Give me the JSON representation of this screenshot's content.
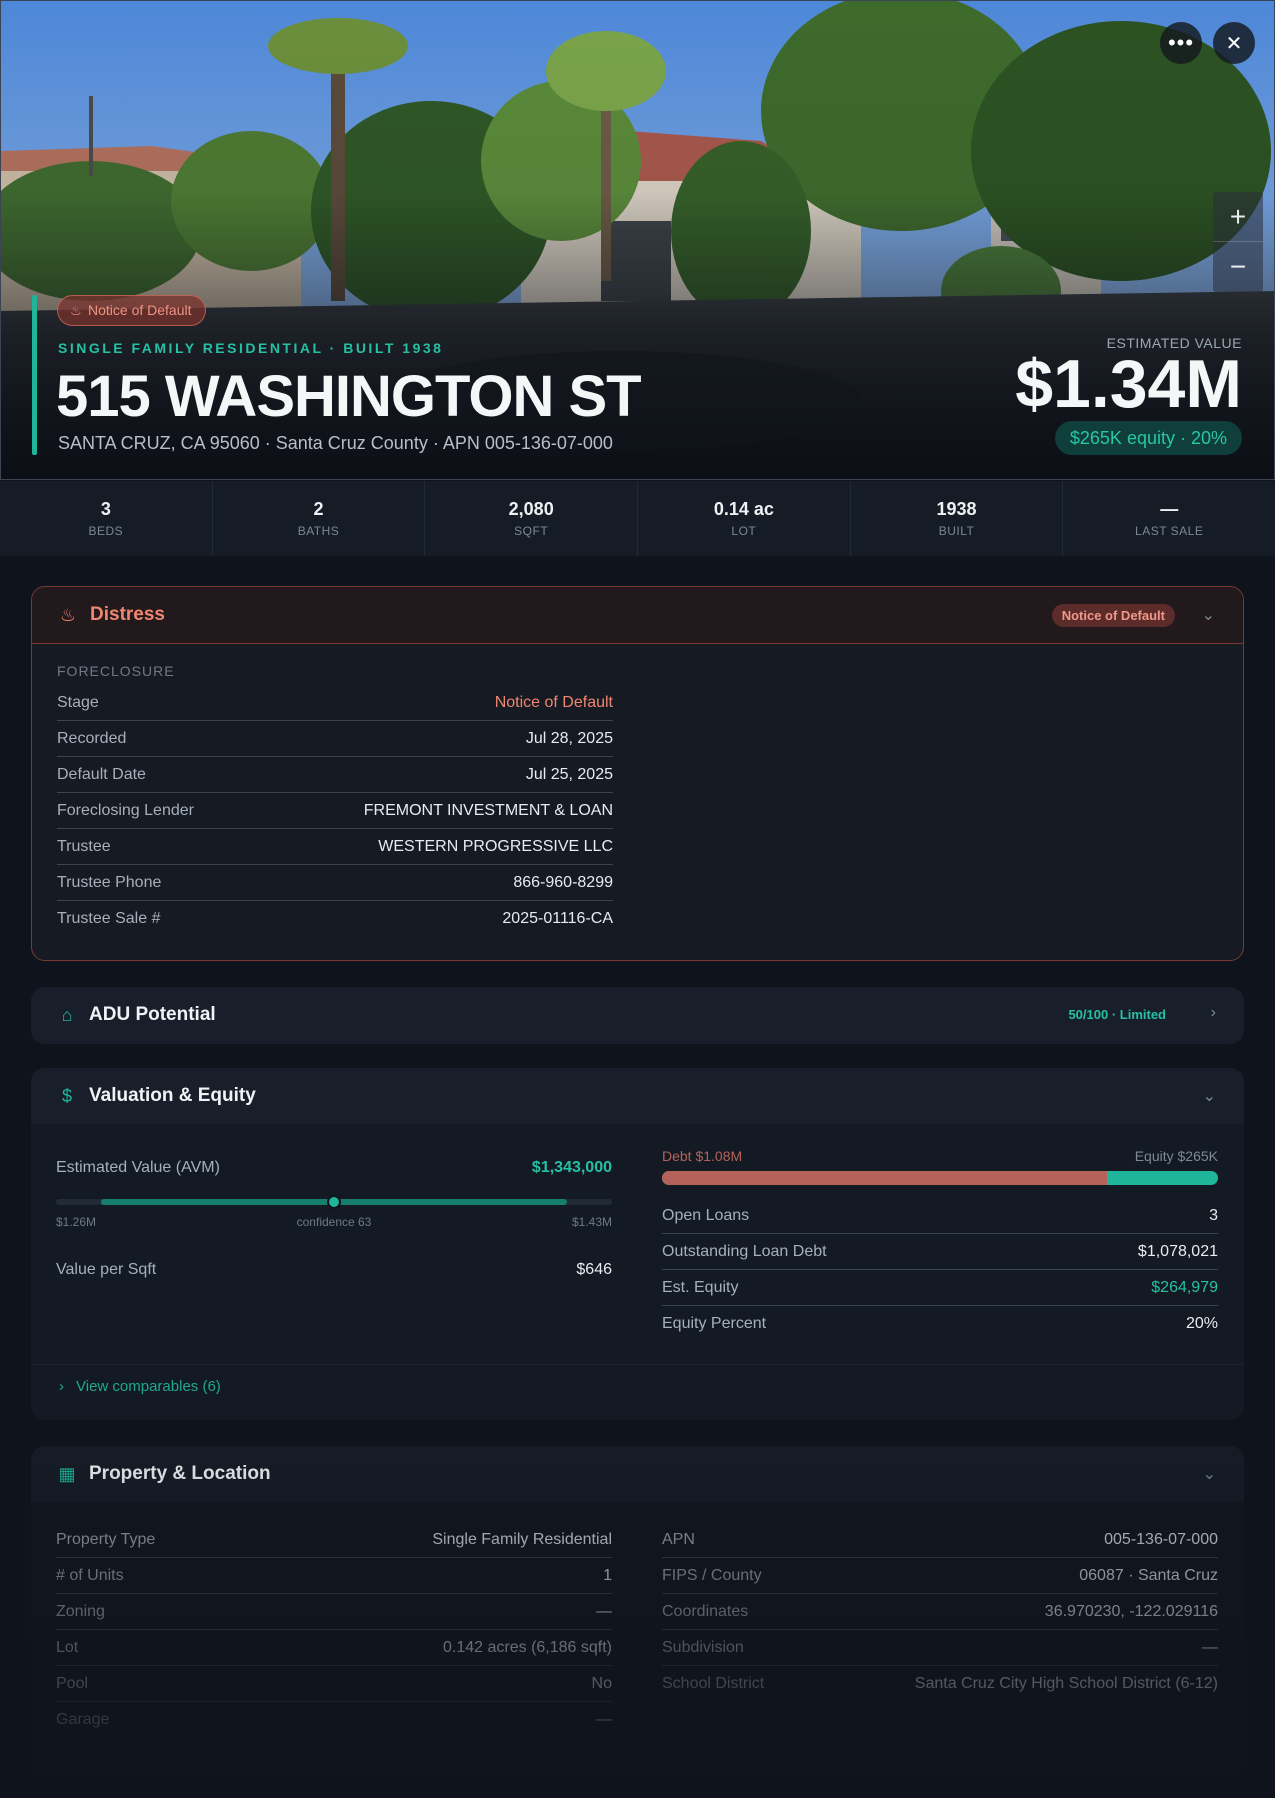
{
  "hero": {
    "distress_badge": "Notice of Default",
    "subtitle": "SINGLE FAMILY RESIDENTIAL · BUILT 1938",
    "address": "515 WASHINGTON ST",
    "location": "SANTA CRUZ, CA 95060 · Santa Cruz County · APN 005-136-07-000",
    "estimated_label": "ESTIMATED VALUE",
    "estimated_value": "$1.34M",
    "equity_pill": "$265K equity · 20%",
    "more_icon": "more-horizontal-icon",
    "close_icon": "close-icon",
    "zoom_in": "+",
    "zoom_out": "−"
  },
  "stats": [
    {
      "value": "3",
      "label": "BEDS"
    },
    {
      "value": "2",
      "label": "BATHS"
    },
    {
      "value": "2,080",
      "label": "SQFT"
    },
    {
      "value": "0.14 ac",
      "label": "LOT"
    },
    {
      "value": "1938",
      "label": "BUILT"
    },
    {
      "value": "—",
      "label": "LAST SALE"
    }
  ],
  "distress": {
    "title": "Distress",
    "badge": "Notice of Default",
    "section": "FORECLOSURE",
    "rows": [
      {
        "k": "Stage",
        "v": "Notice of Default"
      },
      {
        "k": "Recorded",
        "v": "Jul 28, 2025"
      },
      {
        "k": "Default Date",
        "v": "Jul 25, 2025"
      },
      {
        "k": "Foreclosing Lender",
        "v": "FREMONT INVESTMENT & LOAN"
      },
      {
        "k": "Trustee",
        "v": "WESTERN PROGRESSIVE LLC"
      },
      {
        "k": "Trustee Phone",
        "v": "866-960-8299"
      },
      {
        "k": "Trustee Sale #",
        "v": "2025-01116-CA"
      }
    ]
  },
  "adu": {
    "title": "ADU Potential",
    "score": "50/100 · Limited"
  },
  "valuation": {
    "title": "Valuation & Equity",
    "avm_label": "Estimated Value (AVM)",
    "avm_value": "$1,343,000",
    "range_low": "$1.26M",
    "confidence": "confidence 63",
    "range_high": "$1.43M",
    "confidence_fraction": 0.5,
    "sqft_label": "Value per Sqft",
    "sqft_value": "$646",
    "debt_label": "Debt $1.08M",
    "equity_label": "Equity $265K",
    "debt_fraction": 0.8,
    "rows": [
      {
        "k": "Open Loans",
        "v": "3"
      },
      {
        "k": "Outstanding Loan Debt",
        "v": "$1,078,021"
      },
      {
        "k": "Est. Equity",
        "v": "$264,979"
      },
      {
        "k": "Equity Percent",
        "v": "20%"
      }
    ],
    "comparables_link": "View comparables (6)",
    "colors": {
      "debt": "#b4625a",
      "equity": "#1fb59a"
    }
  },
  "property": {
    "title": "Property & Location",
    "left": [
      {
        "k": "Property Type",
        "v": "Single Family Residential"
      },
      {
        "k": "# of Units",
        "v": "1"
      },
      {
        "k": "Zoning",
        "v": "—"
      },
      {
        "k": "Lot",
        "v": "0.142 acres (6,186 sqft)"
      },
      {
        "k": "Pool",
        "v": "No"
      },
      {
        "k": "Garage",
        "v": "—"
      }
    ],
    "right": [
      {
        "k": "APN",
        "v": "005-136-07-000"
      },
      {
        "k": "FIPS / County",
        "v": "06087 · Santa Cruz"
      },
      {
        "k": "Coordinates",
        "v": "36.970230, -122.029116"
      },
      {
        "k": "Subdivision",
        "v": "—"
      },
      {
        "k": "School District",
        "v": "Santa Cruz City High School District (6-12)"
      }
    ]
  }
}
